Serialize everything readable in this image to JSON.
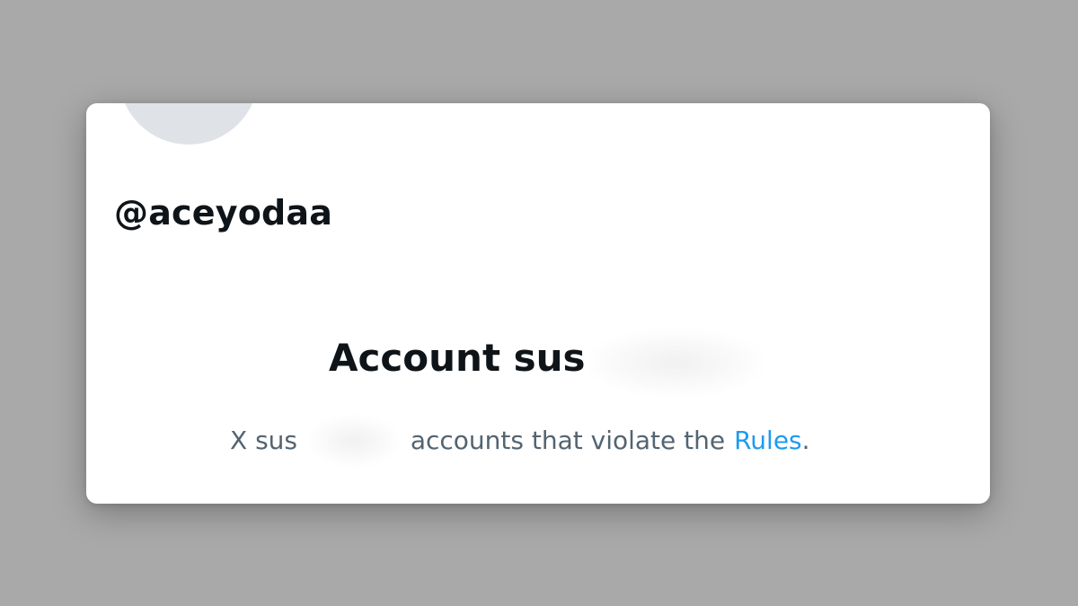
{
  "profile": {
    "handle": "@aceyodaa"
  },
  "suspension": {
    "title": "Account sus",
    "message_start": "X sus",
    "message_end": "accounts that violate the",
    "rules_link": "Rules",
    "message_punctuation": "."
  },
  "colors": {
    "page_background": "#a9a9a9",
    "card_background": "#ffffff",
    "avatar_placeholder": "#dfe3e7",
    "primary_text": "#0f1419",
    "secondary_text": "#536471",
    "link": "#1d9bf0"
  }
}
